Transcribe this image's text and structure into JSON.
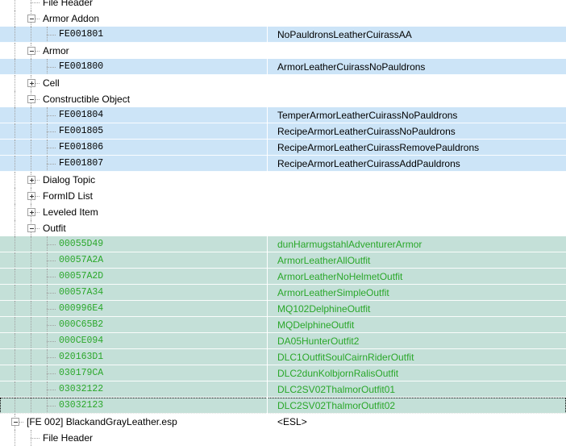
{
  "tree": {
    "rows": [
      {
        "label": "File Header",
        "value": "",
        "level": 2,
        "kind": "leaf",
        "sel": "",
        "mono": false,
        "green": false
      },
      {
        "label": "Armor Addon",
        "value": "",
        "level": 2,
        "kind": "expanded",
        "sel": "",
        "mono": false,
        "green": false
      },
      {
        "label": "FE001801",
        "value": "NoPauldronsLeatherCuirassAA",
        "level": 3,
        "kind": "leaf",
        "sel": "blue",
        "mono": true,
        "green": false
      },
      {
        "label": "Armor",
        "value": "",
        "level": 2,
        "kind": "expanded",
        "sel": "",
        "mono": false,
        "green": false
      },
      {
        "label": "FE001800",
        "value": "ArmorLeatherCuirassNoPauldrons",
        "level": 3,
        "kind": "leaf",
        "sel": "blue",
        "mono": true,
        "green": false
      },
      {
        "label": "Cell",
        "value": "",
        "level": 2,
        "kind": "collapsed",
        "sel": "",
        "mono": false,
        "green": false
      },
      {
        "label": "Constructible Object",
        "value": "",
        "level": 2,
        "kind": "expanded",
        "sel": "",
        "mono": false,
        "green": false
      },
      {
        "label": "FE001804",
        "value": "TemperArmorLeatherCuirassNoPauldrons",
        "level": 3,
        "kind": "leaf",
        "sel": "blue",
        "mono": true,
        "green": false
      },
      {
        "label": "FE001805",
        "value": "RecipeArmorLeatherCuirassNoPauldrons",
        "level": 3,
        "kind": "leaf",
        "sel": "blue",
        "mono": true,
        "green": false
      },
      {
        "label": "FE001806",
        "value": "RecipeArmorLeatherCuirassRemovePauldrons",
        "level": 3,
        "kind": "leaf",
        "sel": "blue",
        "mono": true,
        "green": false
      },
      {
        "label": "FE001807",
        "value": "RecipeArmorLeatherCuirassAddPauldrons",
        "level": 3,
        "kind": "leaf",
        "sel": "blue",
        "mono": true,
        "green": false
      },
      {
        "label": "Dialog Topic",
        "value": "",
        "level": 2,
        "kind": "collapsed",
        "sel": "",
        "mono": false,
        "green": false
      },
      {
        "label": "FormID List",
        "value": "",
        "level": 2,
        "kind": "collapsed",
        "sel": "",
        "mono": false,
        "green": false
      },
      {
        "label": "Leveled Item",
        "value": "",
        "level": 2,
        "kind": "collapsed",
        "sel": "",
        "mono": false,
        "green": false
      },
      {
        "label": "Outfit",
        "value": "",
        "level": 2,
        "kind": "expanded",
        "sel": "",
        "mono": false,
        "green": false
      },
      {
        "label": "00055D49",
        "value": "dunHarmugstahlAdventurerArmor",
        "level": 3,
        "kind": "leaf",
        "sel": "teal",
        "mono": true,
        "green": true
      },
      {
        "label": "00057A2A",
        "value": "ArmorLeatherAllOutfit",
        "level": 3,
        "kind": "leaf",
        "sel": "teal",
        "mono": true,
        "green": true
      },
      {
        "label": "00057A2D",
        "value": "ArmorLeatherNoHelmetOutfit",
        "level": 3,
        "kind": "leaf",
        "sel": "teal",
        "mono": true,
        "green": true
      },
      {
        "label": "00057A34",
        "value": "ArmorLeatherSimpleOutfit",
        "level": 3,
        "kind": "leaf",
        "sel": "teal",
        "mono": true,
        "green": true
      },
      {
        "label": "000996E4",
        "value": "MQ102DelphineOutfit",
        "level": 3,
        "kind": "leaf",
        "sel": "teal",
        "mono": true,
        "green": true
      },
      {
        "label": "000C65B2",
        "value": "MQDelphineOutfit",
        "level": 3,
        "kind": "leaf",
        "sel": "teal",
        "mono": true,
        "green": true
      },
      {
        "label": "000CE094",
        "value": "DA05HunterOutfit2",
        "level": 3,
        "kind": "leaf",
        "sel": "teal",
        "mono": true,
        "green": true
      },
      {
        "label": "020163D1",
        "value": "DLC1OutfitSoulCairnRiderOutfit",
        "level": 3,
        "kind": "leaf",
        "sel": "teal",
        "mono": true,
        "green": true
      },
      {
        "label": "030179CA",
        "value": "DLC2dunKolbjornRalisOutfit",
        "level": 3,
        "kind": "leaf",
        "sel": "teal",
        "mono": true,
        "green": true
      },
      {
        "label": "03032122",
        "value": "DLC2SV02ThalmorOutfit01",
        "level": 3,
        "kind": "leaf",
        "sel": "teal",
        "mono": true,
        "green": true
      },
      {
        "label": "03032123",
        "value": "DLC2SV02ThalmorOutfit02",
        "level": 3,
        "kind": "leaf",
        "sel": "teal",
        "mono": true,
        "green": true,
        "focus": true
      },
      {
        "label": "[FE 002] BlackandGrayLeather.esp",
        "value": "<ESL>",
        "level": 1,
        "kind": "expanded",
        "sel": "",
        "mono": false,
        "green": false
      },
      {
        "label": "File Header",
        "value": "",
        "level": 2,
        "kind": "leaf",
        "sel": "",
        "mono": false,
        "green": false
      }
    ]
  },
  "colors": {
    "selection_blue": "#cce4f7",
    "selection_teal": "#c4e0d8",
    "green_text": "#2aa72a",
    "tree_lines": "#a0a0a0"
  }
}
